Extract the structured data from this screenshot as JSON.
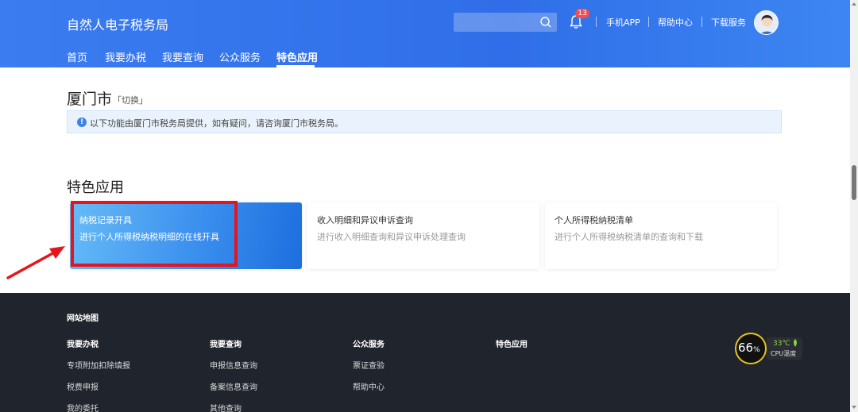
{
  "header": {
    "title": "自然人电子税务局",
    "notification_count": "13",
    "links": [
      "手机APP",
      "帮助中心",
      "下载服务"
    ],
    "nav": [
      "首页",
      "我要办税",
      "我要查询",
      "公众服务",
      "特色应用"
    ],
    "active_nav": "特色应用"
  },
  "city": {
    "name": "厦门市",
    "switch_label": "「切换」",
    "notice": "以下功能由厦门市税务局提供，如有疑问，请咨询厦门市税务局。"
  },
  "section": {
    "title": "特色应用",
    "cards": [
      {
        "title": "纳税记录开具",
        "desc": "进行个人所得税纳税明细的在线开具"
      },
      {
        "title": "收入明细和异议申诉查询",
        "desc": "进行收入明细查询和异议申诉处理查询"
      },
      {
        "title": "个人所得税纳税清单",
        "desc": "进行个人所得税纳税清单的查询和下载"
      }
    ]
  },
  "footer": {
    "heading": "网站地图",
    "columns": [
      {
        "title": "我要办税",
        "links": [
          "专项附加扣除填报",
          "税费申报",
          "我的委托"
        ]
      },
      {
        "title": "我要查询",
        "links": [
          "申报信息查询",
          "备案信息查询",
          "其他查询"
        ]
      },
      {
        "title": "公众服务",
        "links": [
          "票证查验",
          "帮助中心"
        ]
      },
      {
        "title": "特色应用",
        "links": []
      }
    ]
  },
  "cpu_widget": {
    "percent": "66",
    "percent_unit": "%",
    "temperature": "33℃",
    "label": "CPU温度"
  },
  "colors": {
    "header_blue": "#2f6ee8",
    "highlight_red": "#e7141b",
    "footer_bg": "#20242d",
    "active_card": "#3b8fee"
  }
}
